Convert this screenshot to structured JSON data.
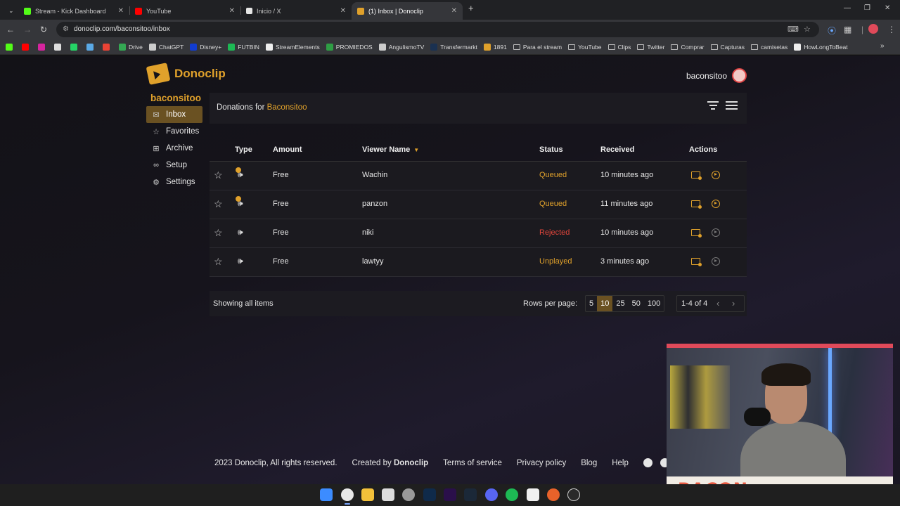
{
  "browser": {
    "tabs": [
      {
        "title": "Stream - Kick Dashboard",
        "icon": "kick-icon",
        "color": "#53fc18"
      },
      {
        "title": "YouTube",
        "icon": "youtube-icon",
        "color": "#ff0000"
      },
      {
        "title": "Inicio / X",
        "icon": "x-icon",
        "color": "#ffffff"
      },
      {
        "title": "(1) Inbox | Donoclip",
        "icon": "donoclip-icon",
        "color": "#e0a12b"
      }
    ],
    "url": "donoclip.com/baconsitoo/inbox",
    "bookmarks": [
      {
        "label": "",
        "icon": "kick-icon",
        "color": "#53fc18"
      },
      {
        "label": "",
        "icon": "youtube-icon",
        "color": "#ff0000"
      },
      {
        "label": "",
        "icon": "instagram-icon",
        "color": "#d6249f"
      },
      {
        "label": "",
        "icon": "x-icon",
        "color": "#dddddd"
      },
      {
        "label": "",
        "icon": "whatsapp-icon",
        "color": "#25d366"
      },
      {
        "label": "",
        "icon": "onedrive-icon",
        "color": "#5aa9e6"
      },
      {
        "label": "",
        "icon": "gmail-icon",
        "color": "#ea4335"
      },
      {
        "label": "Drive",
        "icon": "drive-icon",
        "color": "#34a853"
      },
      {
        "label": "ChatGPT",
        "icon": "chatgpt-icon",
        "color": "#cccccc"
      },
      {
        "label": "Disney+",
        "icon": "disney-icon",
        "color": "#113ccf"
      },
      {
        "label": "FUTBIN",
        "icon": "futbin-icon",
        "color": "#1db954"
      },
      {
        "label": "StreamElements",
        "icon": "streamelements-icon",
        "color": "#eeeeee"
      },
      {
        "label": "PROMIEDOS",
        "icon": "promiedos-icon",
        "color": "#2e9e44"
      },
      {
        "label": "AngulismoTV",
        "icon": "angulismo-icon",
        "color": "#cccccc"
      },
      {
        "label": "Transfermarkt",
        "icon": "transfermarkt-icon",
        "color": "#1a3151"
      },
      {
        "label": "1891",
        "icon": "trophy-icon",
        "color": "#e0a12b"
      },
      {
        "label": "Para el stream",
        "icon": "folder-icon",
        "color": ""
      },
      {
        "label": "YouTube",
        "icon": "folder-icon",
        "color": ""
      },
      {
        "label": "Clips",
        "icon": "folder-icon",
        "color": ""
      },
      {
        "label": "Twitter",
        "icon": "folder-icon",
        "color": ""
      },
      {
        "label": "Comprar",
        "icon": "folder-icon",
        "color": ""
      },
      {
        "label": "Capturas",
        "icon": "folder-icon",
        "color": ""
      },
      {
        "label": "camisetas",
        "icon": "folder-icon",
        "color": ""
      },
      {
        "label": "HowLongToBeat",
        "icon": "hltb-icon",
        "color": "#eeeeee"
      }
    ]
  },
  "app": {
    "brand": "Donoclip",
    "username": "baconsitoo",
    "sidebar": {
      "user": "baconsitoo",
      "items": [
        {
          "label": "Inbox",
          "icon": "inbox-icon",
          "glyph": "✉",
          "active": true
        },
        {
          "label": "Favorites",
          "icon": "star-icon",
          "glyph": "☆",
          "active": false
        },
        {
          "label": "Archive",
          "icon": "archive-icon",
          "glyph": "⊞",
          "active": false
        },
        {
          "label": "Setup",
          "icon": "link-icon",
          "glyph": "∞",
          "active": false
        },
        {
          "label": "Settings",
          "icon": "gear-icon",
          "glyph": "⚙",
          "active": false
        }
      ]
    },
    "panel": {
      "title_prefix": "Donations for ",
      "title_name": "Baconsitoo"
    },
    "table": {
      "headers": {
        "type": "Type",
        "amount": "Amount",
        "viewer": "Viewer Name",
        "status": "Status",
        "received": "Received",
        "actions": "Actions"
      },
      "rows": [
        {
          "type": "tts-coin",
          "amount": "Free",
          "viewer": "Wachin",
          "status": "Queued",
          "status_kind": "queued",
          "received": "10 minutes ago",
          "play_enabled": true
        },
        {
          "type": "tts-coin",
          "amount": "Free",
          "viewer": "panzon",
          "status": "Queued",
          "status_kind": "queued",
          "received": "11 minutes ago",
          "play_enabled": true
        },
        {
          "type": "tts",
          "amount": "Free",
          "viewer": "niki",
          "status": "Rejected",
          "status_kind": "rejected",
          "received": "10 minutes ago",
          "play_enabled": false
        },
        {
          "type": "tts",
          "amount": "Free",
          "viewer": "lawtyy",
          "status": "Unplayed",
          "status_kind": "unplayed",
          "received": "3 minutes ago",
          "play_enabled": false
        }
      ]
    },
    "pagination": {
      "showing": "Showing all items",
      "rows_label": "Rows per page:",
      "options": [
        "5",
        "10",
        "25",
        "50",
        "100"
      ],
      "selected": "10",
      "range": "1-4 of 4"
    },
    "footer": {
      "copyright": "2023 Donoclip, All rights reserved.",
      "created_by": "Created by ",
      "created_brand": "Donoclip",
      "terms": "Terms of service",
      "privacy": "Privacy policy",
      "blog": "Blog",
      "help": "Help"
    }
  },
  "webcam": {
    "overlay_text": "BACON"
  },
  "colors": {
    "accent": "#e0a12b",
    "rejected": "#e0453b",
    "active_bg": "#6a5122"
  }
}
